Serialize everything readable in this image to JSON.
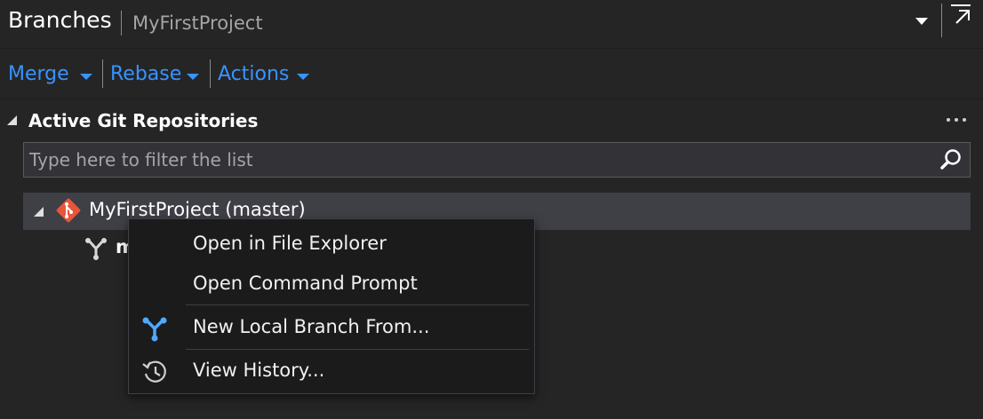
{
  "header": {
    "title": "Branches",
    "subtitle": "MyFirstProject"
  },
  "toolbar": {
    "merge": "Merge",
    "rebase": "Rebase",
    "actions": "Actions"
  },
  "section": {
    "title": "Active Git Repositories"
  },
  "filter": {
    "placeholder": "Type here to filter the list"
  },
  "repo": {
    "label": "MyFirstProject (master)"
  },
  "branch": {
    "label": "m"
  },
  "context_menu": {
    "items": [
      {
        "label": "Open in File Explorer",
        "icon": "none"
      },
      {
        "label": "Open Command Prompt",
        "icon": "none"
      },
      {
        "label": "New Local Branch From...",
        "icon": "branch-icon"
      },
      {
        "label": "View History...",
        "icon": "history-icon"
      }
    ]
  },
  "colors": {
    "background": "#252526",
    "accent": "#3794ff",
    "selected_row": "#3f3f46",
    "menu_background": "#1b1b1c",
    "git_logo": "#e8553a",
    "branch_icon_menu": "#4fa9ff"
  }
}
